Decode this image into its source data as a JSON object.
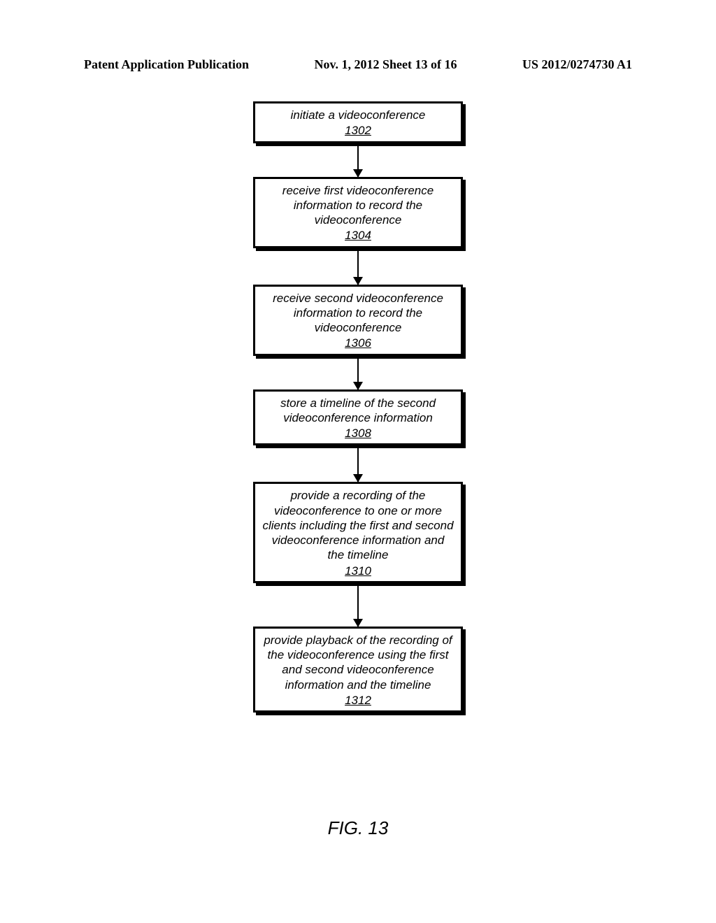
{
  "header": {
    "left": "Patent Application Publication",
    "center": "Nov. 1, 2012  Sheet 13 of 16",
    "right": "US 2012/0274730 A1"
  },
  "flow": {
    "steps": [
      {
        "text": "initiate a videoconference",
        "num": "1302",
        "conn_h": 48
      },
      {
        "text": "receive first videoconference information to record the videoconference",
        "num": "1304",
        "conn_h": 52
      },
      {
        "text": "receive second videoconference information to record the videoconference",
        "num": "1306",
        "conn_h": 48
      },
      {
        "text": "store a timeline of the second videoconference information",
        "num": "1308",
        "conn_h": 52
      },
      {
        "text": "provide a recording of the videoconference to one or more clients including the first and second videoconference information and the timeline",
        "num": "1310",
        "conn_h": 62
      },
      {
        "text": "provide playback of the recording of the videoconference using the first and second videoconference information and the timeline",
        "num": "1312",
        "conn_h": 0
      }
    ]
  },
  "figure_label": "FIG. 13"
}
